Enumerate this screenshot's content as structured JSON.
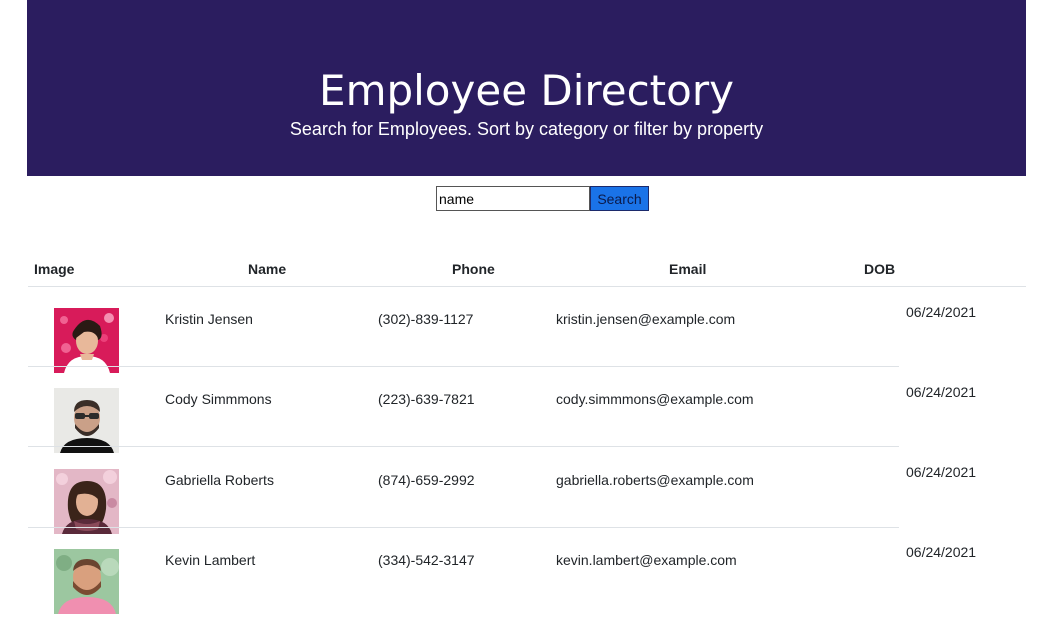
{
  "header": {
    "title": "Employee Directory",
    "subtitle": "Search for Employees. Sort by category or filter by property"
  },
  "search": {
    "value": "name",
    "button_label": "Search"
  },
  "table": {
    "columns": [
      "Image",
      "Name",
      "Phone",
      "Email",
      "DOB"
    ],
    "rows": [
      {
        "name": "Kristin Jensen",
        "phone": "(302)-839-1127",
        "email": "kristin.jensen@example.com",
        "dob": "06/24/2021"
      },
      {
        "name": "Cody Simmmons",
        "phone": "(223)-639-7821",
        "email": "cody.simmmons@example.com",
        "dob": "06/24/2021"
      },
      {
        "name": "Gabriella Roberts",
        "phone": "(874)-659-2992",
        "email": "gabriella.roberts@example.com",
        "dob": "06/24/2021"
      },
      {
        "name": "Kevin Lambert",
        "phone": "(334)-542-3147",
        "email": "kevin.lambert@example.com",
        "dob": "06/24/2021"
      }
    ]
  },
  "colors": {
    "header_bg": "#2b1d5f",
    "button_bg": "#1a73e8"
  }
}
